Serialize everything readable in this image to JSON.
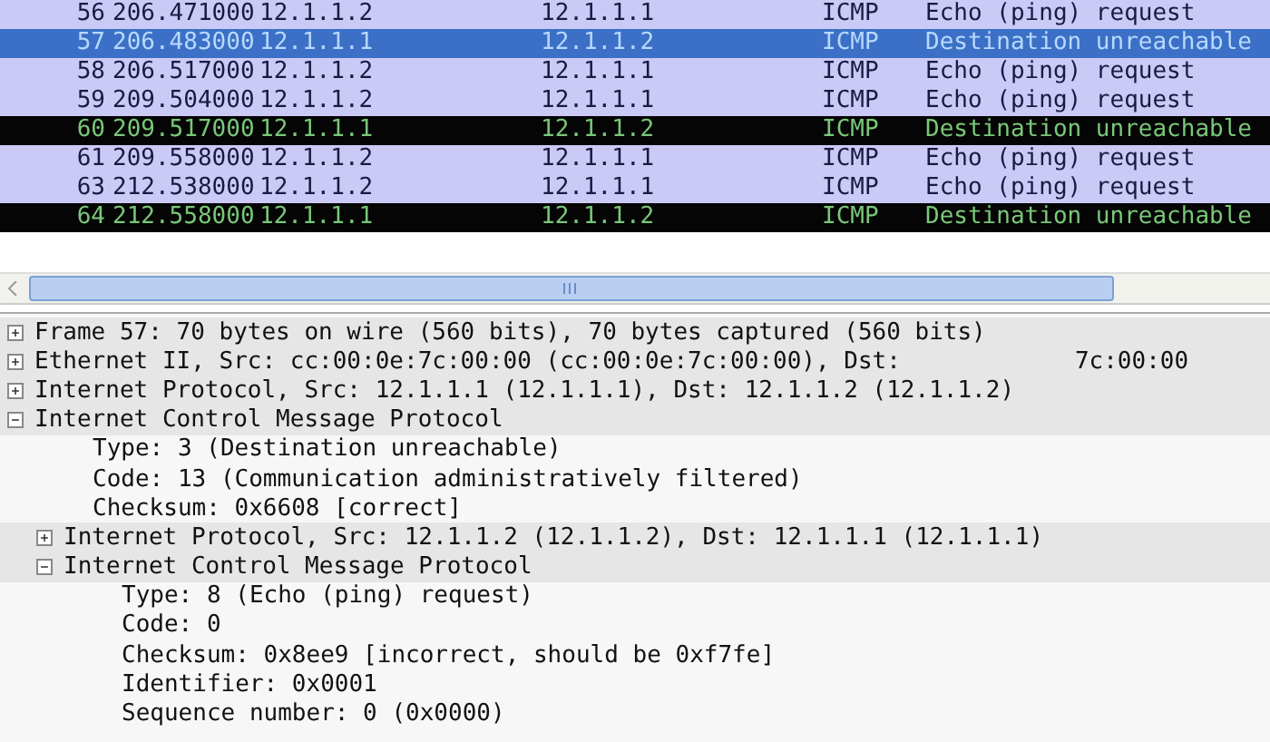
{
  "packets": [
    {
      "no": "56",
      "time": "206.471000",
      "source": "12.1.1.2",
      "destination": "12.1.1.1",
      "protocol": "ICMP",
      "info": "Echo (ping) request",
      "kind": "plain",
      "selected": false
    },
    {
      "no": "57",
      "time": "206.483000",
      "source": "12.1.1.1",
      "destination": "12.1.1.2",
      "protocol": "ICMP",
      "info": "Destination unreachable",
      "selected": true
    },
    {
      "no": "58",
      "time": "206.517000",
      "source": "12.1.1.2",
      "destination": "12.1.1.1",
      "protocol": "ICMP",
      "info": "Echo (ping) request",
      "kind": "plain",
      "selected": false
    },
    {
      "no": "59",
      "time": "209.504000",
      "source": "12.1.1.2",
      "destination": "12.1.1.1",
      "protocol": "ICMP",
      "info": "Echo (ping) request",
      "kind": "plain",
      "selected": false
    },
    {
      "no": "60",
      "time": "209.517000",
      "source": "12.1.1.1",
      "destination": "12.1.1.2",
      "protocol": "ICMP",
      "info": "Destination unreachable",
      "kind": "alert",
      "selected": false
    },
    {
      "no": "61",
      "time": "209.558000",
      "source": "12.1.1.2",
      "destination": "12.1.1.1",
      "protocol": "ICMP",
      "info": "Echo (ping) request",
      "kind": "plain",
      "selected": false
    },
    {
      "no": "63",
      "time": "212.538000",
      "source": "12.1.1.2",
      "destination": "12.1.1.1",
      "protocol": "ICMP",
      "info": "Echo (ping) request",
      "kind": "plain",
      "selected": false
    },
    {
      "no": "64",
      "time": "212.558000",
      "source": "12.1.1.1",
      "destination": "12.1.1.2",
      "protocol": "ICMP",
      "info": "Destination unreachable",
      "kind": "alert",
      "selected": false
    }
  ],
  "details": [
    {
      "text": "Frame 57: 70 bytes on wire (560 bits), 70 bytes captured (560 bits)",
      "expanded": false
    },
    {
      "text": "Ethernet II, Src: cc:00:0e:7c:00:00 (cc:00:0e:7c:00:00), Dst:",
      "tail": "7c:00:00",
      "expanded": false
    },
    {
      "text": "Internet Protocol, Src: 12.1.1.1 (12.1.1.1), Dst: 12.1.1.2 (12.1.1.2)",
      "expanded": false
    },
    {
      "text": "Internet Control Message Protocol",
      "expanded": true,
      "children": [
        {
          "text": "Type: 3 (Destination unreachable)"
        },
        {
          "text": "Code: 13 (Communication administratively filtered)"
        },
        {
          "text": "Checksum: 0x6608 [correct]"
        },
        {
          "text": "Internet Protocol, Src: 12.1.1.2 (12.1.1.2), Dst: 12.1.1.1 (12.1.1.1)",
          "expanded": false
        },
        {
          "text": "Internet Control Message Protocol",
          "expanded": true,
          "children": [
            {
              "text": "Type: 8 (Echo (ping) request)"
            },
            {
              "text": "Code: 0"
            },
            {
              "text": "Checksum: 0x8ee9 [incorrect, should be 0xf7fe]"
            },
            {
              "text": "Identifier: 0x0001"
            },
            {
              "text": "Sequence number: 0 (0x0000)"
            }
          ]
        }
      ]
    }
  ]
}
